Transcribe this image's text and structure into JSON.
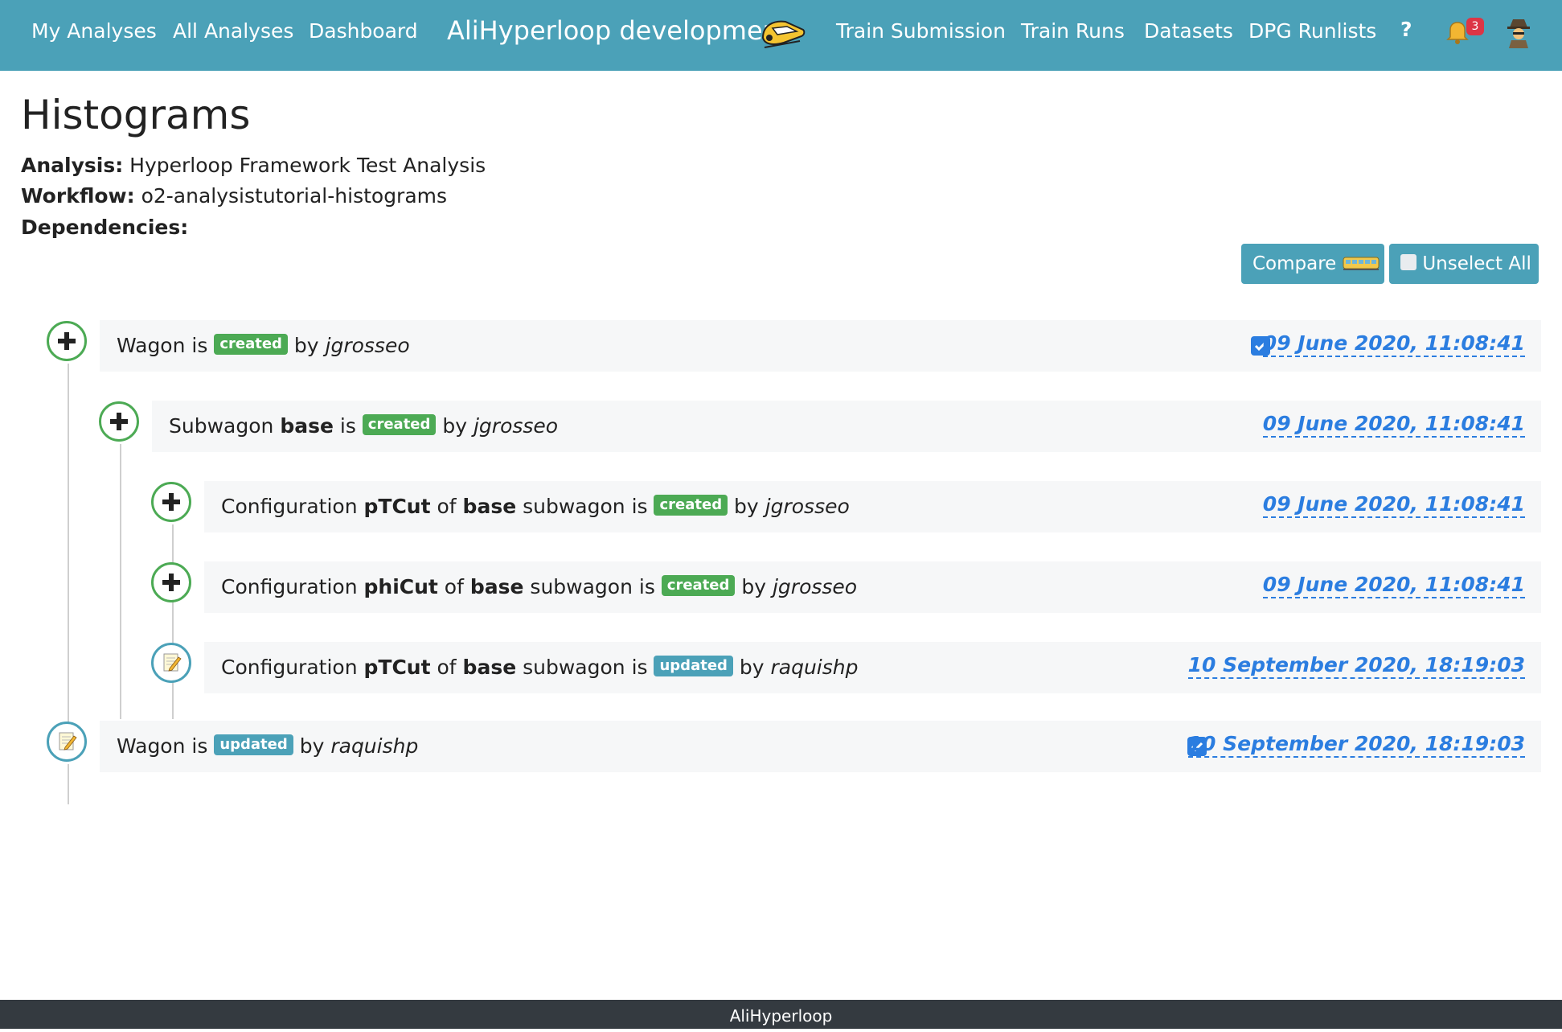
{
  "navbar": {
    "left_links": [
      "My Analyses",
      "All Analyses",
      "Dashboard"
    ],
    "brand": "AliHyperloop development",
    "right_links": [
      "Train Submission",
      "Train Runs",
      "Datasets",
      "DPG Runlists"
    ],
    "help": "?",
    "notification_count": "3"
  },
  "header": {
    "title": "Histograms",
    "analysis_label": "Analysis:",
    "analysis_value": "Hyperloop Framework Test Analysis",
    "workflow_label": "Workflow:",
    "workflow_value": "o2-analysistutorial-histograms",
    "dependencies_label": "Dependencies:"
  },
  "toolbar": {
    "compare_label": "Compare",
    "unselect_label": "Unselect All"
  },
  "timeline": [
    {
      "kind": "created",
      "parts": [
        {
          "t": "Wagon is "
        }
      ],
      "status": "created",
      "by": "by ",
      "user": "jgrosseo",
      "checked": true,
      "timestamp": "09 June 2020, 11:08:41"
    },
    {
      "kind": "created",
      "parts": [
        {
          "t": "Subwagon "
        },
        {
          "t": "base",
          "b": true
        },
        {
          "t": " is "
        }
      ],
      "status": "created",
      "by": "by ",
      "user": "jgrosseo",
      "checked": false,
      "timestamp": "09 June 2020, 11:08:41"
    },
    {
      "kind": "created",
      "parts": [
        {
          "t": "Configuration "
        },
        {
          "t": "pTCut",
          "b": true
        },
        {
          "t": " of "
        },
        {
          "t": "base",
          "b": true
        },
        {
          "t": " subwagon is "
        }
      ],
      "status": "created",
      "by": "by ",
      "user": "jgrosseo",
      "checked": false,
      "timestamp": "09 June 2020, 11:08:41"
    },
    {
      "kind": "created",
      "parts": [
        {
          "t": "Configuration "
        },
        {
          "t": "phiCut",
          "b": true
        },
        {
          "t": " of "
        },
        {
          "t": "base",
          "b": true
        },
        {
          "t": " subwagon is "
        }
      ],
      "status": "created",
      "by": "by ",
      "user": "jgrosseo",
      "checked": false,
      "timestamp": "09 June 2020, 11:08:41"
    },
    {
      "kind": "updated",
      "parts": [
        {
          "t": "Configuration "
        },
        {
          "t": "pTCut",
          "b": true
        },
        {
          "t": " of "
        },
        {
          "t": "base",
          "b": true
        },
        {
          "t": " subwagon is "
        }
      ],
      "status": "updated",
      "by": "by ",
      "user": "raquishp",
      "checked": false,
      "timestamp": "10 September 2020, 18:19:03"
    },
    {
      "kind": "updated",
      "parts": [
        {
          "t": "Wagon is "
        }
      ],
      "status": "updated",
      "by": "by ",
      "user": "raquishp",
      "checked": true,
      "timestamp": "10 September 2020, 18:19:03"
    }
  ],
  "footer": {
    "text": "AliHyperloop"
  },
  "colors": {
    "navbar": "#4ba1b8",
    "created": "#4caa54",
    "updated": "#4ba1b8",
    "link": "#2b7de0",
    "footer": "#343a40"
  },
  "icons": {
    "brand": "train-icon",
    "notifications": "bell-icon",
    "user": "spy-icon",
    "compare": "tram-icon",
    "unselect": "square-checkbox-icon",
    "created": "plus-icon",
    "updated": "memo-icon"
  }
}
